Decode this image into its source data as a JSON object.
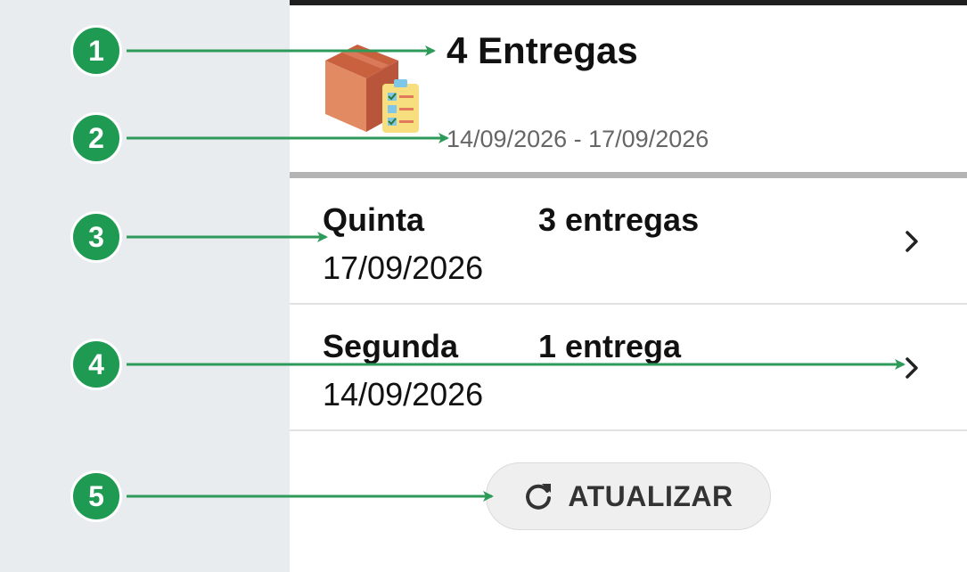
{
  "summary": {
    "title": "4 Entregas",
    "date_range": "14/09/2026  - 17/09/2026"
  },
  "days": [
    {
      "day": "Quinta",
      "count": "3 entregas",
      "date": "17/09/2026"
    },
    {
      "day": "Segunda",
      "count": "1 entrega",
      "date": "14/09/2026"
    }
  ],
  "refresh": {
    "label": "ATUALIZAR"
  },
  "callouts": [
    "1",
    "2",
    "3",
    "4",
    "5"
  ],
  "colors": {
    "callout": "#1f9a52",
    "arrow": "#2e9a5a",
    "top_bar": "#1f1f1f"
  }
}
